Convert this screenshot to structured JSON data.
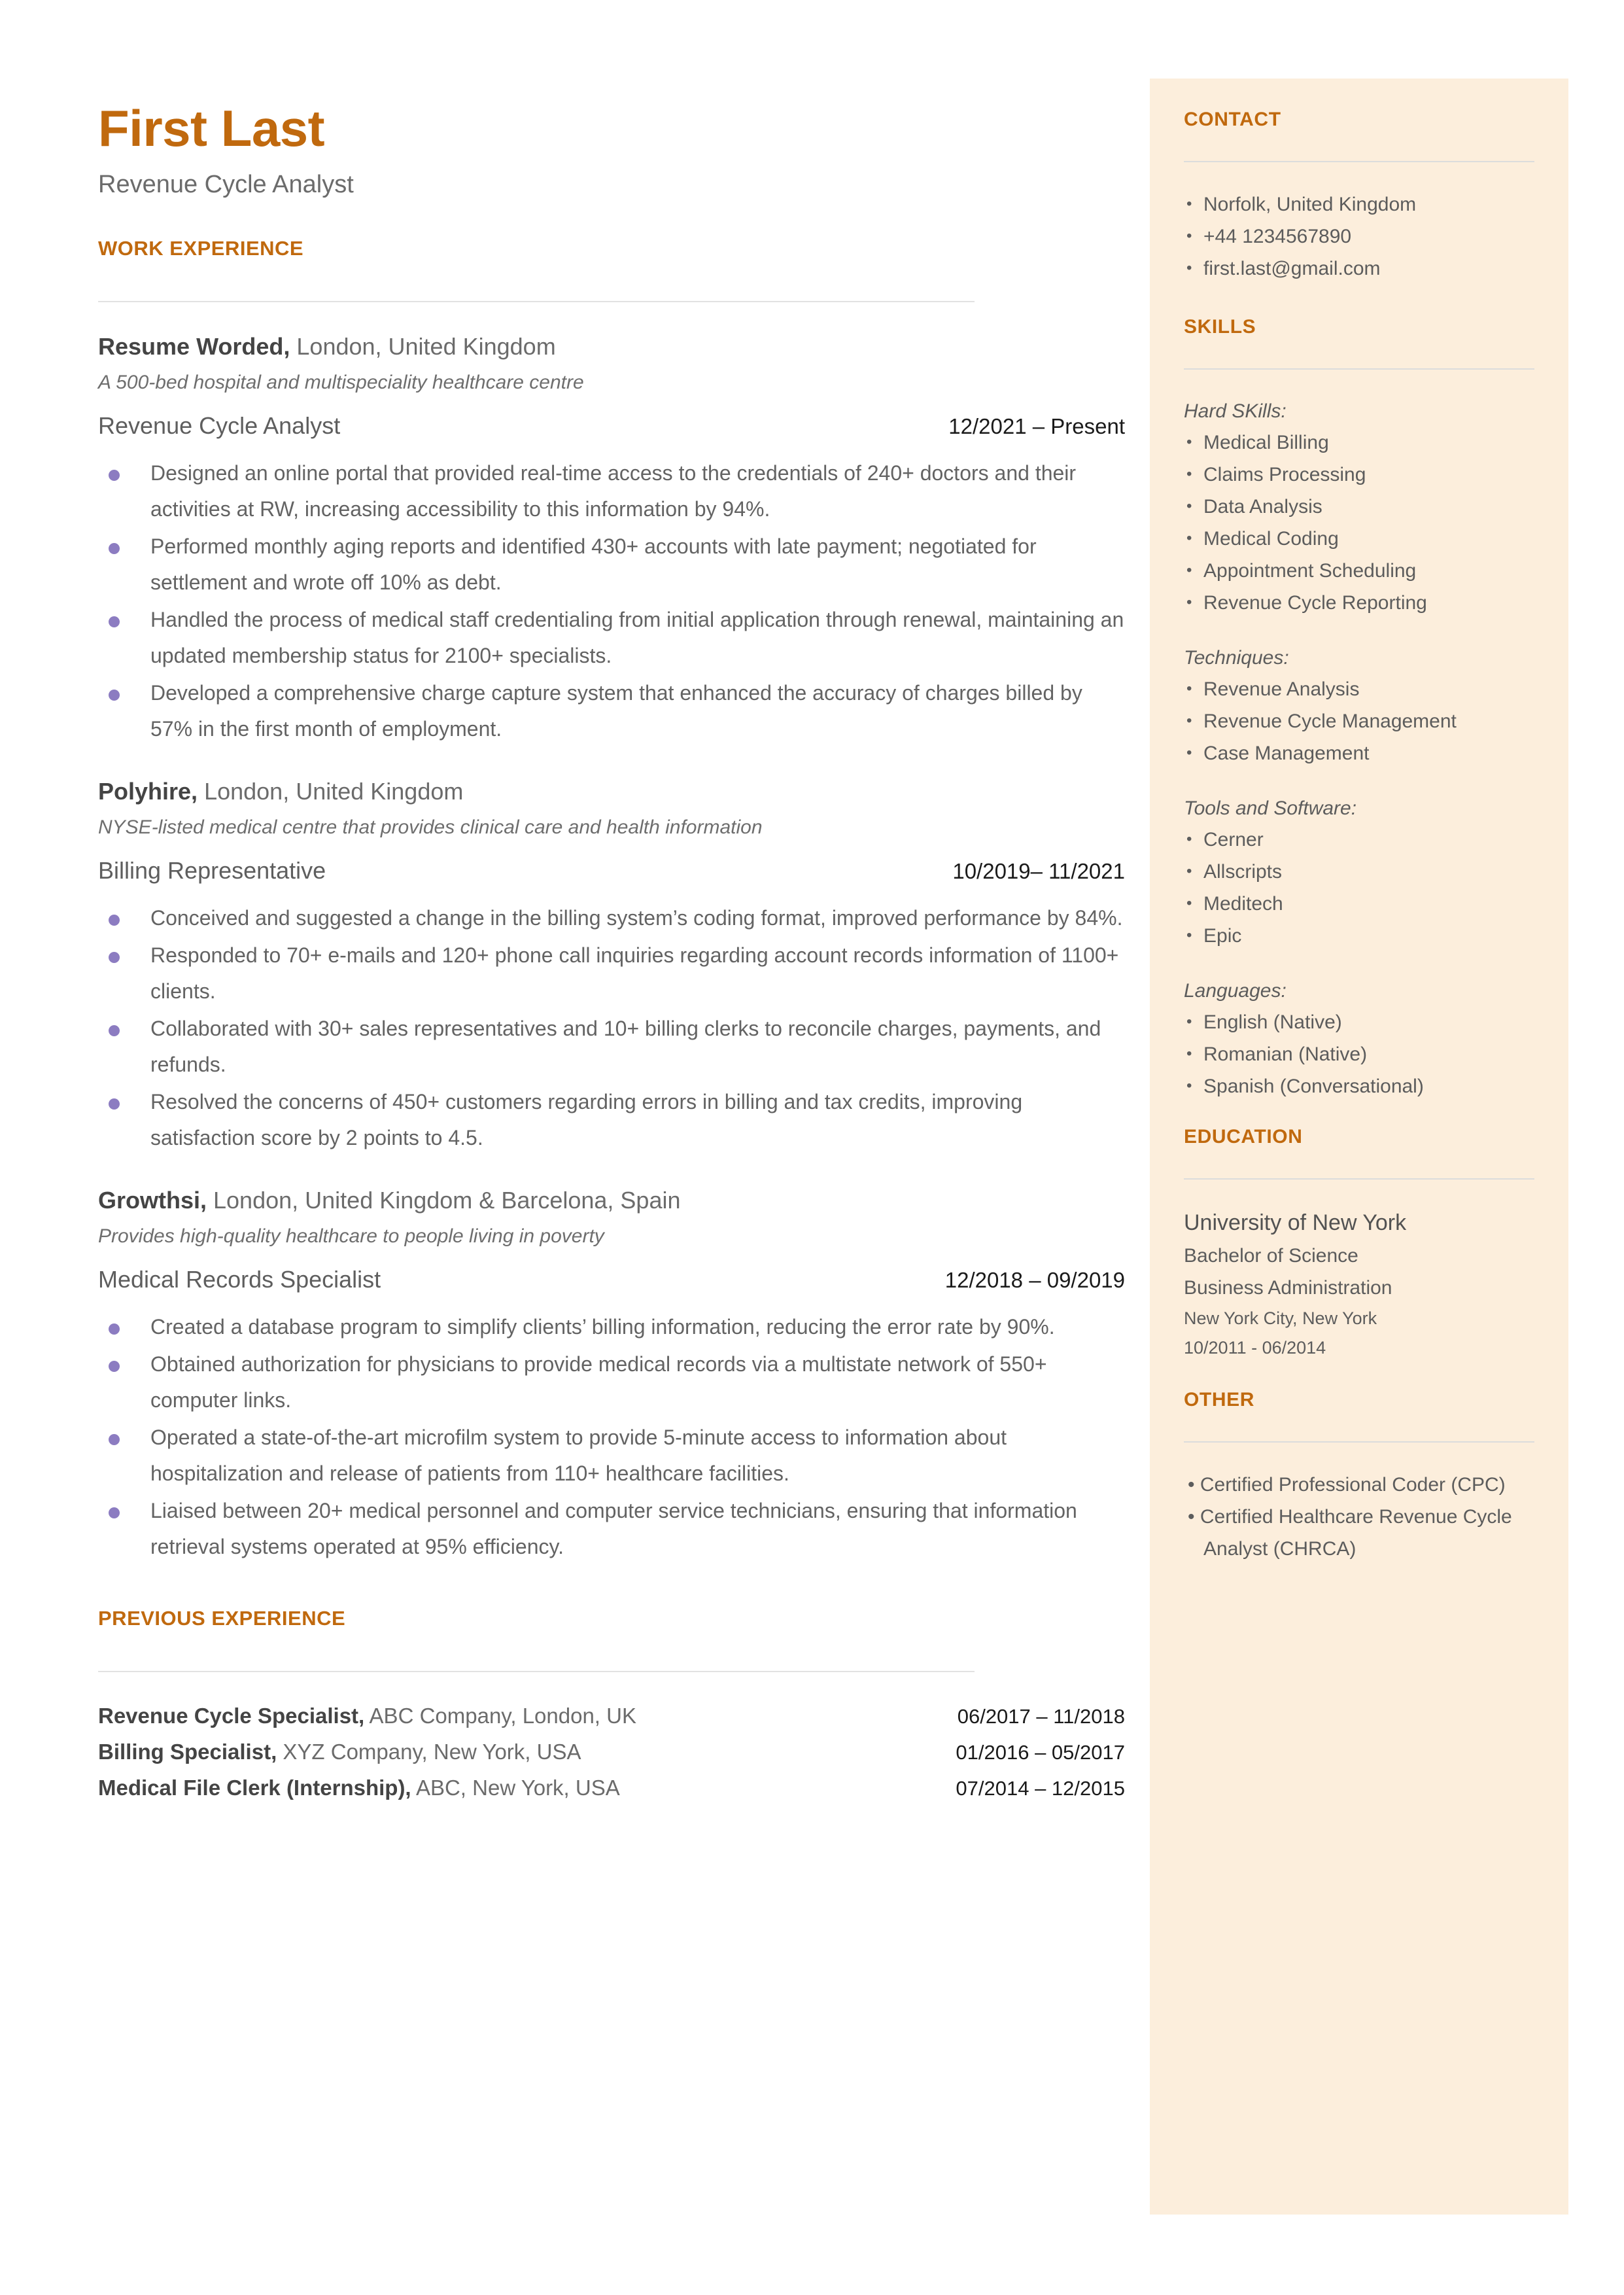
{
  "theme": {
    "accent": "#C0690E",
    "sidebar_bg": "#FCEEDC",
    "bullet": "#8C7CC1",
    "body_text": "#636363"
  },
  "header": {
    "name": "First Last",
    "tagline": "Revenue Cycle Analyst"
  },
  "work": {
    "heading": "WORK EXPERIENCE",
    "jobs": [
      {
        "company": "Resume Worded,",
        "location": " London, United Kingdom",
        "description": "A 500-bed hospital and multispeciality healthcare centre",
        "title": "Revenue Cycle Analyst",
        "dates": "12/2021 – Present",
        "bullets": [
          "Designed an online portal that provided real-time access to the credentials of 240+ doctors and their activities at RW, increasing accessibility to this information by 94%.",
          "Performed monthly aging reports and identified 430+ accounts with late payment; negotiated for settlement and wrote off 10% as debt.",
          "Handled the process of medical staff credentialing from initial application through renewal, maintaining an updated membership status for 2100+ specialists.",
          "Developed a comprehensive charge capture system that enhanced the accuracy of charges billed by 57%  in the first month of employment."
        ]
      },
      {
        "company": "Polyhire,",
        "location": " London, United Kingdom",
        "description": "NYSE-listed medical centre that provides clinical care and health information",
        "title": "Billing Representative",
        "dates": "10/2019– 11/2021",
        "bullets": [
          "Conceived and suggested a change in the billing system’s coding format, improved performance by 84%.",
          "Responded to 70+ e-mails and 120+ phone call inquiries regarding account records information of 1100+ clients.",
          "Collaborated with 30+ sales representatives and 10+ billing clerks to reconcile charges, payments, and refunds.",
          "Resolved the concerns of 450+ customers regarding errors in billing and tax credits, improving satisfaction score by 2 points to 4.5."
        ]
      },
      {
        "company": "Growthsi,",
        "location": " London, United Kingdom & Barcelona, Spain",
        "description": "Provides high-quality healthcare to people living in poverty",
        "title": "Medical Records Specialist",
        "dates": "12/2018 – 09/2019",
        "bullets": [
          "Created a database program to simplify clients’ billing information, reducing the error rate by 90%.",
          "Obtained authorization for physicians to provide medical records via a multistate network of 550+ computer links.",
          "Operated a state-of-the-art microfilm system to provide 5-minute access to information about hospitalization and release of patients from 110+ healthcare facilities.",
          "Liaised between 20+ medical personnel and computer service technicians, ensuring that information retrieval systems operated at 95% efficiency."
        ]
      }
    ]
  },
  "previous": {
    "heading": "PREVIOUS EXPERIENCE",
    "rows": [
      {
        "role": "Revenue Cycle Specialist,",
        "detail": " ABC Company, London, UK",
        "dates": "06/2017 – 11/2018"
      },
      {
        "role": "Billing Specialist,",
        "detail": " XYZ Company, New York, USA",
        "dates": "01/2016 – 05/2017"
      },
      {
        "role": "Medical File Clerk (Internship),",
        "detail": " ABC, New York, USA",
        "dates": "07/2014 – 12/2015"
      }
    ]
  },
  "contact": {
    "heading": "CONTACT",
    "items": [
      "Norfolk, United Kingdom",
      "+44 1234567890",
      "first.last@gmail.com"
    ]
  },
  "skills": {
    "heading": "SKILLS",
    "groups": [
      {
        "label": "Hard SKills:",
        "items": [
          "Medical Billing",
          "Claims Processing",
          "Data Analysis",
          "Medical Coding",
          "Appointment Scheduling",
          "Revenue Cycle Reporting"
        ]
      },
      {
        "label": "Techniques:",
        "items": [
          "Revenue Analysis",
          "Revenue Cycle Management",
          "Case Management"
        ]
      },
      {
        "label": "Tools and Software:",
        "items": [
          "Cerner",
          "Allscripts",
          "Meditech",
          "Epic"
        ]
      },
      {
        "label": "Languages:",
        "items": [
          "English (Native)",
          "Romanian (Native)",
          "Spanish (Conversational)"
        ]
      }
    ]
  },
  "education": {
    "heading": "EDUCATION",
    "school": "University of New York",
    "degree": "Bachelor of Science",
    "field": "Business Administration",
    "location": "New York City, New York",
    "dates": "10/2011 - 06/2014"
  },
  "other": {
    "heading": "OTHER",
    "items": [
      "Certified Professional Coder (CPC)",
      "Certified Healthcare Revenue Cycle Analyst (CHRCA)"
    ]
  }
}
